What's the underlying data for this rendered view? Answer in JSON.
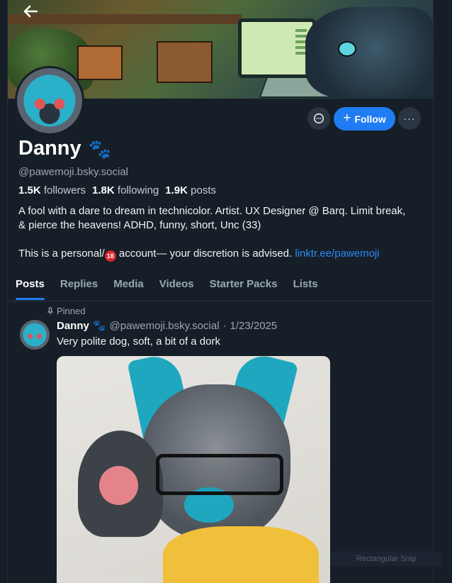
{
  "profile": {
    "name": "Danny",
    "name_emoji": "🐾",
    "handle": "@pawemoji.bsky.social",
    "followers_count": "1.5K",
    "followers_label": "followers",
    "following_count": "1.8K",
    "following_label": "following",
    "posts_count": "1.9K",
    "posts_label": "posts",
    "bio_line1": "A fool with a dare to dream in technicolor. Artist. UX Designer @ Barq. Limit break, & pierce the heavens! ADHD, funny, short, Unc (33)",
    "bio_line2_prefix": "This is a personal/",
    "bio_badge": "18",
    "bio_line2_suffix": " account— your discretion is advised.",
    "bio_link": "linktr.ee/pawemoji"
  },
  "actions": {
    "follow_label": "Follow",
    "follow_plus": "+",
    "more_label": "···"
  },
  "tabs": [
    {
      "label": "Posts",
      "active": true
    },
    {
      "label": "Replies",
      "active": false
    },
    {
      "label": "Media",
      "active": false
    },
    {
      "label": "Videos",
      "active": false
    },
    {
      "label": "Starter Packs",
      "active": false
    },
    {
      "label": "Lists",
      "active": false
    }
  ],
  "post": {
    "pinned_label": "Pinned",
    "author_name": "Danny",
    "author_emoji": "🐾",
    "author_handle": "@pawemoji.bsky.social",
    "separator": "·",
    "date": "1/23/2025",
    "text": "Very polite dog, soft, a bit of a dork"
  },
  "overlay": {
    "snip_label": "Rectangular Snip"
  },
  "colors": {
    "background": "#161e27",
    "accent": "#1f7cf2",
    "link": "#2b8af7",
    "muted_text": "#9aa7b4"
  }
}
